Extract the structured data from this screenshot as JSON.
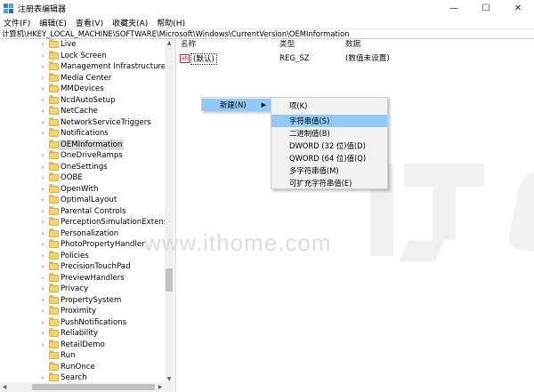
{
  "window": {
    "title": "注册表编辑器",
    "minimize_glyph": "—",
    "maximize_glyph": "☐",
    "close_glyph": "✕"
  },
  "menu": [
    "文件(F)",
    "编辑(E)",
    "查看(V)",
    "收藏夹(A)",
    "帮助(H)"
  ],
  "address": "计算机\\HKEY_LOCAL_MACHINE\\SOFTWARE\\Microsoft\\Windows\\CurrentVersion\\OEMInformation",
  "tree": {
    "items": [
      {
        "label": "Live",
        "expandable": true
      },
      {
        "label": "Lock Screen",
        "expandable": true
      },
      {
        "label": "Management Infrastructure",
        "expandable": true
      },
      {
        "label": "Media Center",
        "expandable": true
      },
      {
        "label": "MMDevices",
        "expandable": true
      },
      {
        "label": "NcdAutoSetup",
        "expandable": true
      },
      {
        "label": "NetCache",
        "expandable": true
      },
      {
        "label": "NetworkServiceTriggers",
        "expandable": true
      },
      {
        "label": "Notifications",
        "expandable": true
      },
      {
        "label": "OEMInformation",
        "expandable": false,
        "selected": true
      },
      {
        "label": "OneDriveRamps",
        "expandable": true
      },
      {
        "label": "OneSettings",
        "expandable": true
      },
      {
        "label": "OOBE",
        "expandable": true
      },
      {
        "label": "OpenWith",
        "expandable": true
      },
      {
        "label": "OptimalLayout",
        "expandable": true
      },
      {
        "label": "Parental Controls",
        "expandable": true
      },
      {
        "label": "PerceptionSimulationExtensions",
        "expandable": true
      },
      {
        "label": "Personalization",
        "expandable": true
      },
      {
        "label": "PhotoPropertyHandler",
        "expandable": true
      },
      {
        "label": "Policies",
        "expandable": true
      },
      {
        "label": "PrecisionTouchPad",
        "expandable": true
      },
      {
        "label": "PreviewHandlers",
        "expandable": true
      },
      {
        "label": "Privacy",
        "expandable": true
      },
      {
        "label": "PropertySystem",
        "expandable": true
      },
      {
        "label": "Proximity",
        "expandable": true
      },
      {
        "label": "PushNotifications",
        "expandable": true
      },
      {
        "label": "Reliability",
        "expandable": true
      },
      {
        "label": "RetailDemo",
        "expandable": true
      },
      {
        "label": "Run",
        "expandable": false
      },
      {
        "label": "RunOnce",
        "expandable": false
      },
      {
        "label": "Search",
        "expandable": true
      }
    ],
    "expand_glyph": "›"
  },
  "values": {
    "columns": {
      "name": "名称",
      "type": "类型",
      "data": "数据"
    },
    "rows": [
      {
        "icon": "ab",
        "name": "(默认)",
        "type": "REG_SZ",
        "data": "(数值未设置)"
      }
    ]
  },
  "context_menu": {
    "new_label": "新建(N)",
    "submenu": [
      "项(K)",
      "字符串值(S)",
      "二进制值(B)",
      "DWORD (32 位)值(D)",
      "QWORD (64 位)值(Q)",
      "多字符串值(M)",
      "可扩充字符串值(E)"
    ],
    "highlighted_index": 1
  },
  "watermark": "www.ithome.com",
  "colors": {
    "highlight": "#91c9f7",
    "folder": "#f5d26a",
    "selected_tree": "#d9d9d9"
  }
}
